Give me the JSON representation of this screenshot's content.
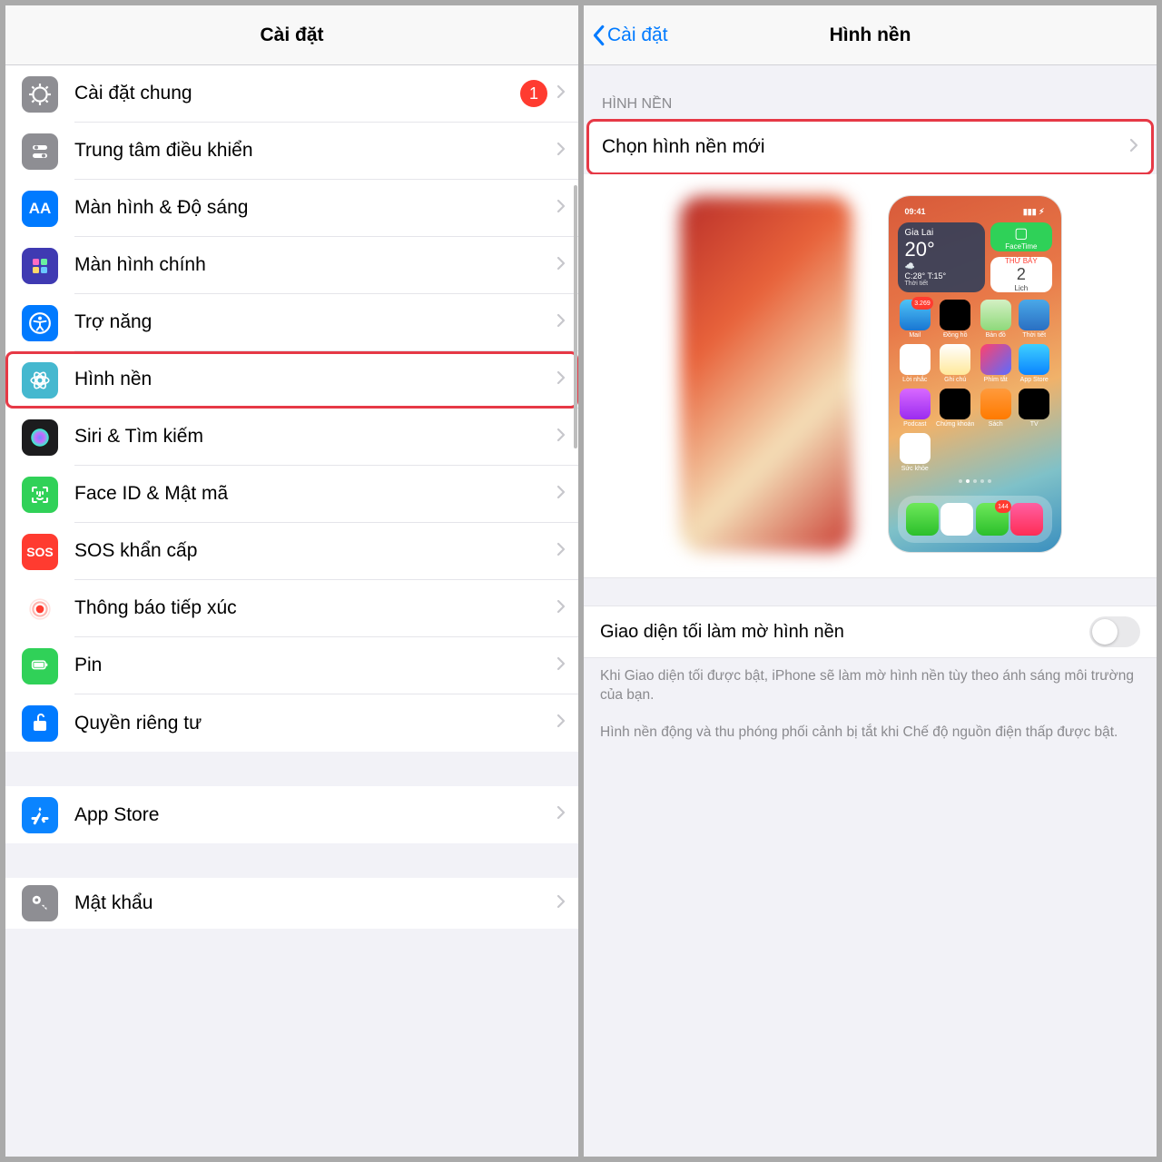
{
  "left": {
    "title": "Cài đặt",
    "groups": [
      [
        {
          "key": "general",
          "label": "Cài đặt chung",
          "badge": "1",
          "iconBg": "#8e8e93"
        },
        {
          "key": "control",
          "label": "Trung tâm điều khiển",
          "iconBg": "#8e8e93"
        },
        {
          "key": "display",
          "label": "Màn hình & Độ sáng",
          "iconBg": "#007aff"
        },
        {
          "key": "homescreen",
          "label": "Màn hình chính",
          "iconBg": "#3f3ab2"
        },
        {
          "key": "accessibility",
          "label": "Trợ năng",
          "iconBg": "#007aff"
        },
        {
          "key": "wallpaper",
          "label": "Hình nền",
          "iconBg": "#45b8cf",
          "highlight": true
        },
        {
          "key": "siri",
          "label": "Siri & Tìm kiếm",
          "iconBg": "#1c1c1e"
        },
        {
          "key": "faceid",
          "label": "Face ID & Mật mã",
          "iconBg": "#30d158"
        },
        {
          "key": "sos",
          "label": "SOS khẩn cấp",
          "iconBg": "#ff3b30",
          "text": "SOS"
        },
        {
          "key": "exposure",
          "label": "Thông báo tiếp xúc",
          "iconBg": "#ffffff"
        },
        {
          "key": "battery",
          "label": "Pin",
          "iconBg": "#30d158"
        },
        {
          "key": "privacy",
          "label": "Quyền riêng tư",
          "iconBg": "#007aff"
        }
      ],
      [
        {
          "key": "appstore",
          "label": "App Store",
          "iconBg": "#0a84ff"
        }
      ],
      [
        {
          "key": "passwords",
          "label": "Mật khẩu",
          "iconBg": "#8e8e93"
        }
      ]
    ]
  },
  "right": {
    "back": "Cài đặt",
    "title": "Hình nền",
    "section": "HÌNH NỀN",
    "choose": "Chọn hình nền mới",
    "home_preview": {
      "time": "09:41",
      "city": "Gia Lai",
      "temp": "20°",
      "cond": "☁️",
      "hi_lo": "C:28° T:15°",
      "now": "Thời tiết",
      "cal_day": "THỨ BẢY",
      "cal_num": "2",
      "apps": [
        {
          "nm": "Mail",
          "bg": "linear-gradient(#4fc3f7,#1976d2)",
          "badge": "3.269"
        },
        {
          "nm": "Đồng hồ",
          "bg": "#000"
        },
        {
          "nm": "Bản đồ",
          "bg": "linear-gradient(#d4f0c4,#8ed97a)"
        },
        {
          "nm": "Thời tiết",
          "bg": "linear-gradient(#4aa8e8,#2a6fc2)"
        },
        {
          "nm": "Lời nhắc",
          "bg": "#fff"
        },
        {
          "nm": "Ghi chú",
          "bg": "linear-gradient(#fff,#ffe89a)"
        },
        {
          "nm": "Phím tắt",
          "bg": "linear-gradient(135deg,#ff416c,#5b6cff)"
        },
        {
          "nm": "App Store",
          "bg": "linear-gradient(#3fd0ff,#0a84ff)"
        },
        {
          "nm": "Podcast",
          "bg": "linear-gradient(#d869ff,#9b2cf0)"
        },
        {
          "nm": "Chứng khoán",
          "bg": "#000"
        },
        {
          "nm": "Sách",
          "bg": "linear-gradient(#ff9a3c,#ff7a00)"
        },
        {
          "nm": "TV",
          "bg": "#000"
        },
        {
          "nm": "Sức khỏe",
          "bg": "#fff"
        }
      ],
      "dock": [
        {
          "bg": "linear-gradient(#6ee85a,#2bbf2b)"
        },
        {
          "bg": "#fff"
        },
        {
          "bg": "linear-gradient(#6ee85a,#2bbf2b)",
          "badge": "144"
        },
        {
          "bg": "linear-gradient(#ff5fa2,#ff2d55)"
        }
      ]
    },
    "dim_label": "Giao diện tối làm mờ hình nền",
    "foot1": "Khi Giao diện tối được bật, iPhone sẽ làm mờ hình nền tùy theo ánh sáng môi trường của bạn.",
    "foot2": "Hình nền động và thu phóng phối cảnh bị tắt khi Chế độ nguồn điện thấp được bật."
  }
}
